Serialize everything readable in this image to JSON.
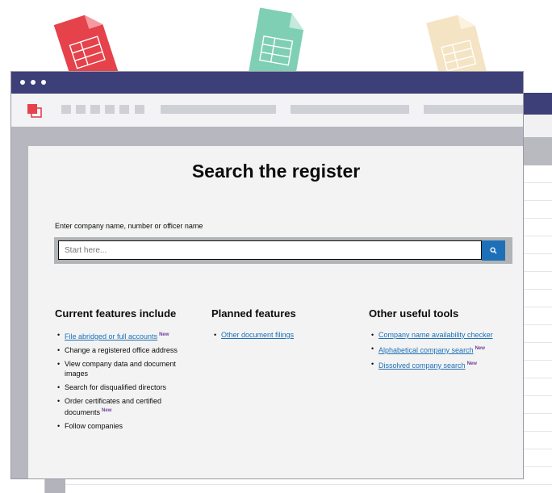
{
  "page": {
    "title": "Search the register",
    "search": {
      "label": "Enter company name, number or officer name",
      "placeholder": "Start here..."
    },
    "new_badge": "New",
    "columns": [
      {
        "heading": "Current features include",
        "items": [
          {
            "text": "File abridged or full accounts",
            "link": true,
            "new": true
          },
          {
            "text": "Change a registered office address",
            "link": false,
            "new": false
          },
          {
            "text": "View company data and document images",
            "link": false,
            "new": false
          },
          {
            "text": "Search for disqualified directors",
            "link": false,
            "new": false
          },
          {
            "text": "Order certificates and certified documents",
            "link": false,
            "new": true
          },
          {
            "text": "Follow companies",
            "link": false,
            "new": false
          }
        ]
      },
      {
        "heading": "Planned features",
        "items": [
          {
            "text": "Other document filings",
            "link": true,
            "new": false
          }
        ]
      },
      {
        "heading": "Other useful tools",
        "items": [
          {
            "text": "Company name availability checker",
            "link": true,
            "new": false
          },
          {
            "text": "Alphabetical company search",
            "link": true,
            "new": true
          },
          {
            "text": "Dissolved company search",
            "link": true,
            "new": true
          }
        ]
      }
    ]
  },
  "icons": [
    "spreadsheet-icon-red",
    "spreadsheet-icon-green",
    "document-icon-beige",
    "app-logo-icon",
    "search-icon"
  ],
  "colors": {
    "titlebar": "#3d3f78",
    "link": "#1d70b8",
    "search_button": "#1d70b8",
    "new_badge": "#6f3f9c",
    "doc_red": "#e5424b",
    "doc_green": "#7fcfb5",
    "doc_beige": "#f4e4c4"
  }
}
